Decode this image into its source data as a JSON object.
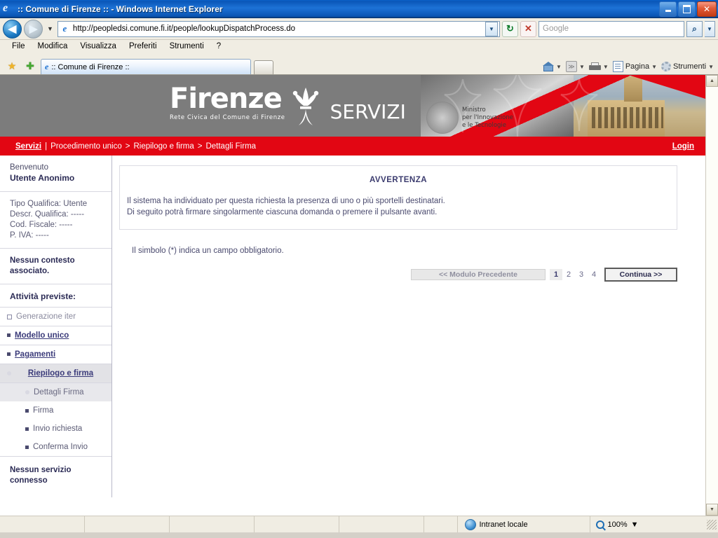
{
  "window": {
    "title": ":: Comune di Firenze :: - Windows Internet Explorer",
    "minimize_label": "Minimize",
    "restore_label": "Restore",
    "close_label": "✕"
  },
  "address_bar": {
    "back_label": "◀",
    "forward_label": "▶",
    "history_dropdown": "▼",
    "url": "http://peopledsi.comune.fi.it/people/lookupDispatchProcess.do",
    "url_dropdown": "▼",
    "refresh_label": "↻",
    "stop_label": "✕",
    "search_placeholder": "Google",
    "search_value": "",
    "search_go_label": "⌕",
    "search_dropdown": "▼"
  },
  "menu": {
    "items": [
      {
        "label": "File"
      },
      {
        "label": "Modifica"
      },
      {
        "label": "Visualizza"
      },
      {
        "label": "Preferiti"
      },
      {
        "label": "Strumenti"
      },
      {
        "label": "?"
      }
    ]
  },
  "tab_bar": {
    "favorites_center_label": "★",
    "add_favorite_label": "✚",
    "tab_title": ":: Comune di Firenze ::",
    "new_tab_label": "",
    "toolbar": [
      {
        "label": "",
        "icon": "home-icon",
        "caret": "▼"
      },
      {
        "label": "",
        "icon": "rss-icon",
        "caret": "▼"
      },
      {
        "label": "",
        "icon": "print-icon",
        "caret": "▼"
      },
      {
        "label": "Pagina",
        "icon": "page-icon",
        "caret": "▼"
      },
      {
        "label": "Strumenti",
        "icon": "gear-icon",
        "caret": "▼"
      }
    ],
    "overflow_label": "»"
  },
  "banner": {
    "brand": "Firenze",
    "tagline": "Rete Civica del Comune di Firenze",
    "servizi": "SERVIZI",
    "ministry_line1": "Ministro",
    "ministry_line2": "per l'Innovazione",
    "ministry_line3": "e le Tecnologie"
  },
  "breadcrumb": {
    "servizi": "Servizi",
    "divider": "|",
    "trail": [
      "Procedimento unico",
      "Riepilogo e firma",
      "Dettagli Firma"
    ],
    "separator": ">",
    "login": "Login"
  },
  "sidebar": {
    "welcome_label": "Benvenuto",
    "user_name": "Utente Anonimo",
    "info_lines": [
      "Tipo Qualifica: Utente",
      "Descr. Qualifica: -----",
      "Cod. Fiscale: -----",
      "P. IVA: -----"
    ],
    "no_context": "Nessun contesto associato.",
    "activities_heading": "Attività previste:",
    "items": [
      {
        "label": "Generazione iter",
        "state": "done"
      },
      {
        "label": "Modello unico",
        "state": "link"
      },
      {
        "label": "Pagamenti",
        "state": "link"
      },
      {
        "label": "Riepilogo e firma",
        "state": "active"
      }
    ],
    "sub_items": [
      {
        "label": "Dettagli Firma",
        "state": "current"
      },
      {
        "label": "Firma",
        "state": "normal"
      },
      {
        "label": "Invio richiesta",
        "state": "normal"
      },
      {
        "label": "Conferma Invio",
        "state": "normal"
      }
    ],
    "no_service": "Nessun servizio connesso"
  },
  "main": {
    "notice_title": "AVVERTENZA",
    "notice_line1": "Il sistema ha individuato per questa richiesta la presenza di uno o più sportelli destinatari.",
    "notice_line2": "Di seguito potrà firmare singolarmente ciascuna domanda o premere il pulsante avanti.",
    "required_note": "Il simbolo (*) indica un campo obbligatorio.",
    "prev_button": "<< Modulo Precedente",
    "pages": [
      "1",
      "2",
      "3",
      "4"
    ],
    "current_page": "1",
    "next_button": "Continua >>"
  },
  "page_scrollbar": {
    "up_label": "▲",
    "down_label": "▼"
  },
  "status_bar": {
    "zone": "Intranet locale",
    "zoom": "100%",
    "zoom_caret": "▼"
  },
  "colors": {
    "brand_red": "#e20613",
    "title_blue": "#1d72d6",
    "banner_gray": "#7c7c7c",
    "link_navy": "#3b3b7a"
  }
}
